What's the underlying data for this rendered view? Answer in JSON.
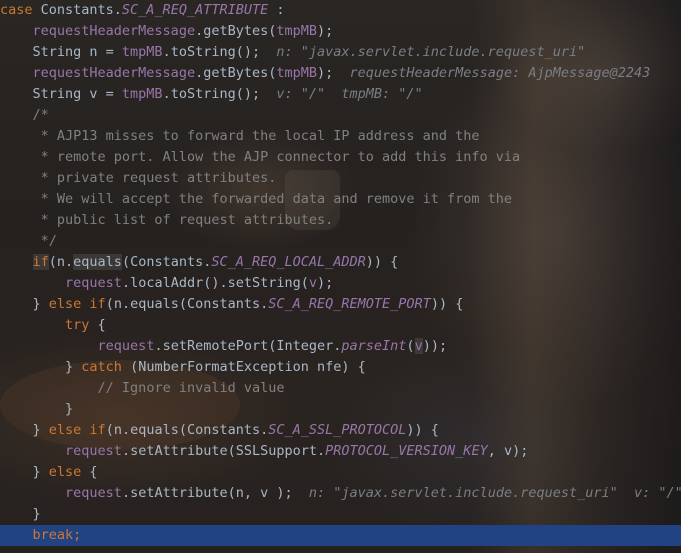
{
  "editor": {
    "lines": [
      {
        "indent": "",
        "tokens": [
          {
            "t": "case",
            "c": "kw"
          },
          {
            "t": " Constants.",
            "c": ""
          },
          {
            "t": "SC_A_REQ_ATTRIBUTE",
            "c": "fld"
          },
          {
            "t": " :",
            "c": ""
          }
        ]
      },
      {
        "indent": "    ",
        "tokens": [
          {
            "t": "requestHeaderMessage",
            "c": "var"
          },
          {
            "t": ".getBytes(",
            "c": ""
          },
          {
            "t": "tmpMB",
            "c": "var"
          },
          {
            "t": ");",
            "c": ""
          }
        ]
      },
      {
        "indent": "    ",
        "tokens": [
          {
            "t": "String n = ",
            "c": ""
          },
          {
            "t": "tmpMB",
            "c": "var"
          },
          {
            "t": ".toString();",
            "c": ""
          },
          {
            "t": "  n: \"javax.servlet.include.request_uri\"",
            "c": "hint"
          }
        ]
      },
      {
        "indent": "    ",
        "tokens": [
          {
            "t": "requestHeaderMessage",
            "c": "var"
          },
          {
            "t": ".getBytes(",
            "c": ""
          },
          {
            "t": "tmpMB",
            "c": "var"
          },
          {
            "t": ");",
            "c": ""
          },
          {
            "t": "  requestHeaderMessage: AjpMessage@2243",
            "c": "hint"
          }
        ]
      },
      {
        "indent": "    ",
        "tokens": [
          {
            "t": "String v = ",
            "c": ""
          },
          {
            "t": "tmpMB",
            "c": "var"
          },
          {
            "t": ".toString();",
            "c": ""
          },
          {
            "t": "  v: \"/\"  tmpMB: \"/\"",
            "c": "hint"
          }
        ]
      },
      {
        "indent": "    ",
        "tokens": [
          {
            "t": "/*",
            "c": "cmt"
          }
        ]
      },
      {
        "indent": "     ",
        "tokens": [
          {
            "t": "* AJP13 misses to forward the local IP address and the",
            "c": "cmt"
          }
        ]
      },
      {
        "indent": "     ",
        "tokens": [
          {
            "t": "* remote port. Allow the AJP connector to add this info via",
            "c": "cmt"
          }
        ]
      },
      {
        "indent": "     ",
        "tokens": [
          {
            "t": "* private request attributes.",
            "c": "cmt"
          }
        ]
      },
      {
        "indent": "     ",
        "tokens": [
          {
            "t": "* We will accept the forwarded data and remove it from the",
            "c": "cmt"
          }
        ]
      },
      {
        "indent": "     ",
        "tokens": [
          {
            "t": "* public list of request attributes.",
            "c": "cmt"
          }
        ]
      },
      {
        "indent": "     ",
        "tokens": [
          {
            "t": "*/",
            "c": "cmt"
          }
        ]
      },
      {
        "indent": "    ",
        "tokens": [
          {
            "t": "if",
            "c": "kw hl-bg"
          },
          {
            "t": "(n.",
            "c": ""
          },
          {
            "t": "equals",
            "c": "hl-bg"
          },
          {
            "t": "(Constants.",
            "c": ""
          },
          {
            "t": "SC_A_REQ_LOCAL_ADDR",
            "c": "fld"
          },
          {
            "t": ")) {",
            "c": ""
          }
        ]
      },
      {
        "indent": "        ",
        "tokens": [
          {
            "t": "request",
            "c": "var"
          },
          {
            "t": ".localAddr().setString(",
            "c": ""
          },
          {
            "t": "v",
            "c": "var"
          },
          {
            "t": ");",
            "c": ""
          }
        ]
      },
      {
        "indent": "    ",
        "tokens": [
          {
            "t": "} ",
            "c": ""
          },
          {
            "t": "else if",
            "c": "kw"
          },
          {
            "t": "(n.equals(Constants.",
            "c": ""
          },
          {
            "t": "SC_A_REQ_REMOTE_PORT",
            "c": "fld"
          },
          {
            "t": ")) {",
            "c": ""
          }
        ]
      },
      {
        "indent": "        ",
        "tokens": [
          {
            "t": "try",
            "c": "kw"
          },
          {
            "t": " {",
            "c": ""
          }
        ]
      },
      {
        "indent": "            ",
        "tokens": [
          {
            "t": "request",
            "c": "var"
          },
          {
            "t": ".setRemotePort(Integer.",
            "c": ""
          },
          {
            "t": "parseInt",
            "c": "mthi"
          },
          {
            "t": "(",
            "c": ""
          },
          {
            "t": "v",
            "c": "var hl-bg"
          },
          {
            "t": "));",
            "c": ""
          }
        ]
      },
      {
        "indent": "        ",
        "tokens": [
          {
            "t": "} ",
            "c": ""
          },
          {
            "t": "catch",
            "c": "kw"
          },
          {
            "t": " (NumberFormatException nfe) {",
            "c": ""
          }
        ]
      },
      {
        "indent": "            ",
        "tokens": [
          {
            "t": "// Ignore invalid value",
            "c": "cmt"
          }
        ]
      },
      {
        "indent": "        ",
        "tokens": [
          {
            "t": "}",
            "c": ""
          }
        ]
      },
      {
        "indent": "    ",
        "tokens": [
          {
            "t": "} ",
            "c": ""
          },
          {
            "t": "else if",
            "c": "kw"
          },
          {
            "t": "(n.equals(Constants.",
            "c": ""
          },
          {
            "t": "SC_A_SSL_PROTOCOL",
            "c": "fld"
          },
          {
            "t": ")) {",
            "c": ""
          }
        ]
      },
      {
        "indent": "        ",
        "tokens": [
          {
            "t": "request",
            "c": "var"
          },
          {
            "t": ".setAttribute(SSLSupport.",
            "c": ""
          },
          {
            "t": "PROTOCOL_VERSION_KEY",
            "c": "fld"
          },
          {
            "t": ", v);",
            "c": ""
          }
        ]
      },
      {
        "indent": "    ",
        "tokens": [
          {
            "t": "} ",
            "c": ""
          },
          {
            "t": "else",
            "c": "kw"
          },
          {
            "t": " {",
            "c": ""
          }
        ]
      },
      {
        "indent": "        ",
        "tokens": [
          {
            "t": "request",
            "c": "var"
          },
          {
            "t": ".setAttribute(n, v );",
            "c": ""
          },
          {
            "t": "  n: \"javax.servlet.include.request_uri\"  v: \"/\"",
            "c": "hint"
          }
        ]
      },
      {
        "indent": "    ",
        "tokens": [
          {
            "t": "}",
            "c": ""
          }
        ]
      },
      {
        "indent": "    ",
        "current": true,
        "tokens": [
          {
            "t": "break",
            "c": "kw"
          },
          {
            "t": ";",
            "c": "kw"
          }
        ]
      }
    ]
  },
  "colors": {
    "keyword": "#cc7832",
    "field": "#9876aa",
    "default": "#a9b7c6",
    "comment": "#808080",
    "hint": "#7a7e85",
    "current_line": "#214283"
  }
}
